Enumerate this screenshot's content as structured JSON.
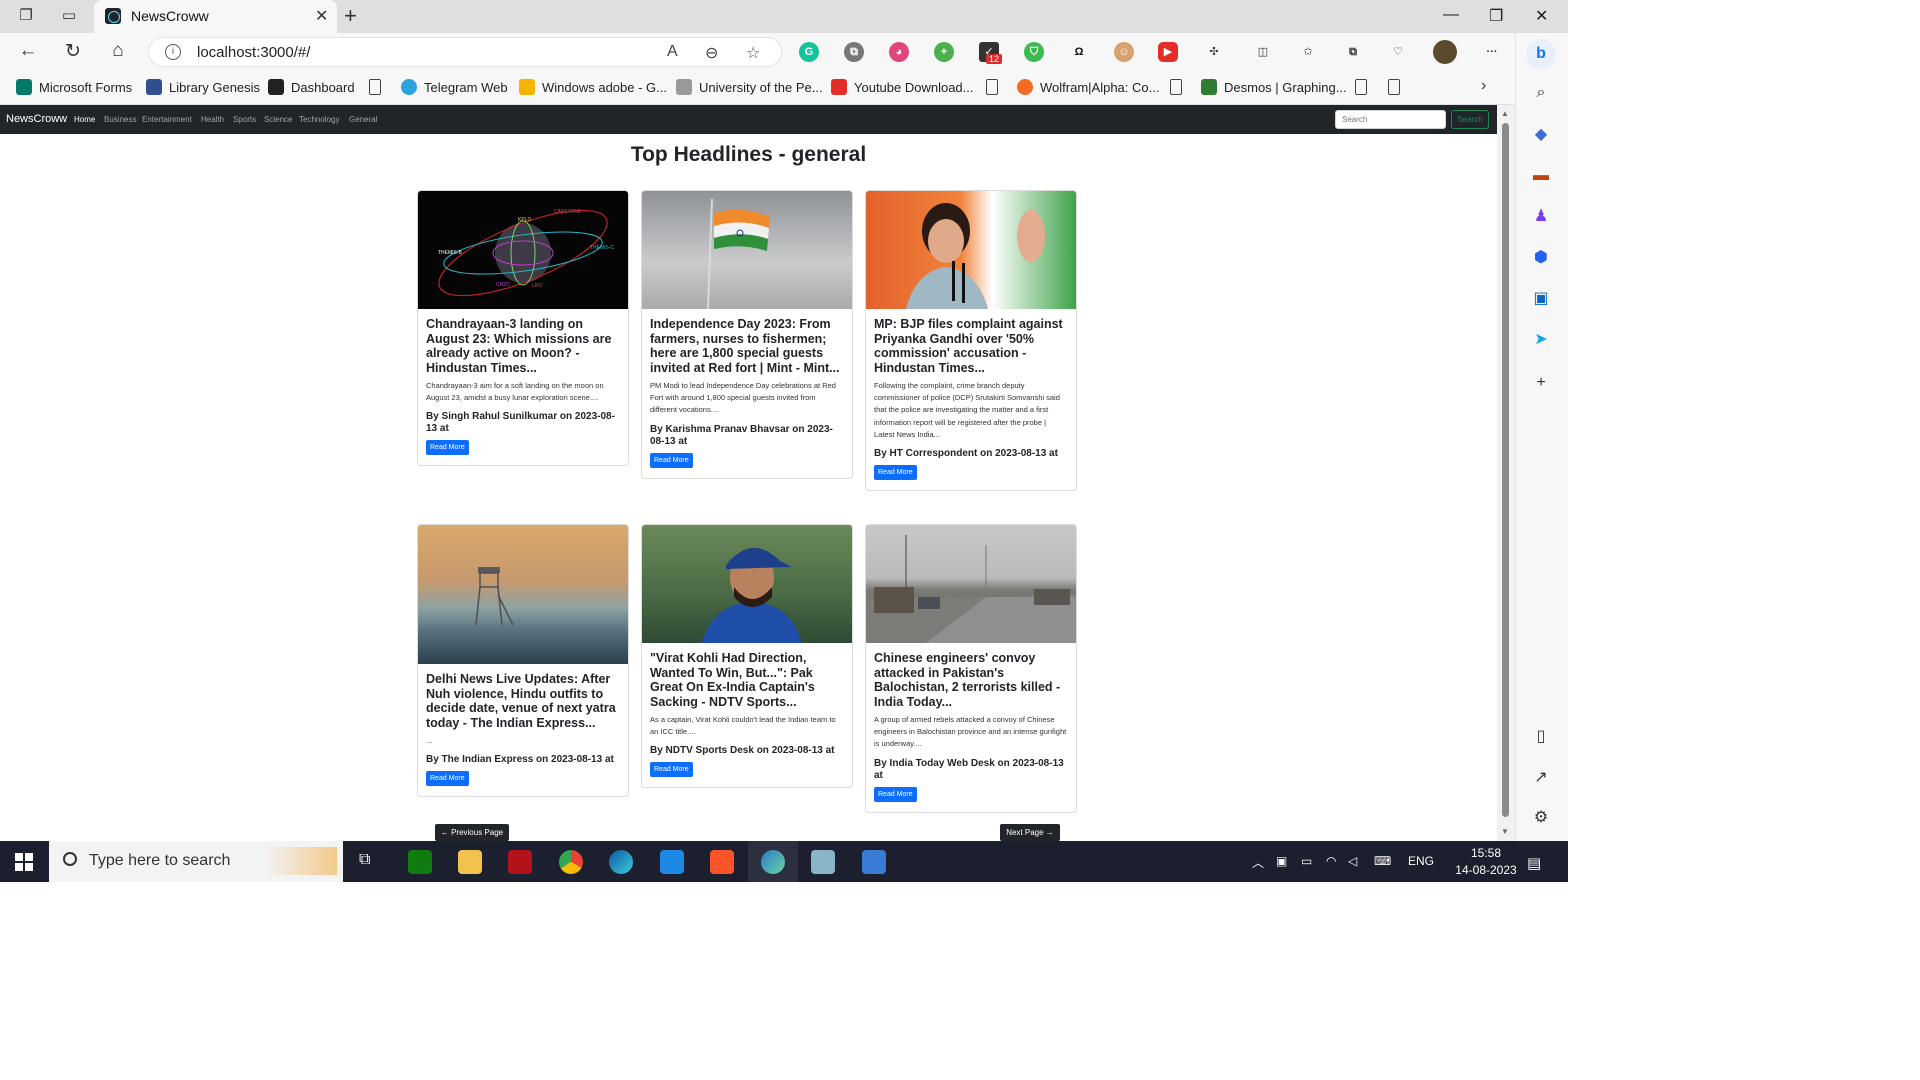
{
  "browser": {
    "tab_title": "NewsCroww",
    "url": "localhost:3000/#/",
    "bookmarks": [
      {
        "label": "Microsoft Forms",
        "color": "#047a6c"
      },
      {
        "label": "Library Genesis",
        "color": "#2f4f8f"
      },
      {
        "label": "Dashboard",
        "color": "#222222"
      },
      {
        "label": "Telegram Web",
        "color": "#2aa3df"
      },
      {
        "label": "Windows adobe - G...",
        "color": "#f4b400"
      },
      {
        "label": "University of the Pe...",
        "color": "#888888"
      },
      {
        "label": "Youtube Download...",
        "color": "#e52d27"
      },
      {
        "label": "Wolfram|Alpha: Co...",
        "color": "#f26d21"
      },
      {
        "label": "Desmos | Graphing...",
        "color": "#2e7d32"
      }
    ],
    "extension_badge": "12"
  },
  "app": {
    "brand": "NewsCroww",
    "nav": [
      "Home",
      "Business",
      "Entertainment",
      "Health",
      "Sports",
      "Science",
      "Technology",
      "General"
    ],
    "search_placeholder": "Search",
    "search_button": "Search",
    "heading": "Top Headlines - general",
    "read_more": "Read More",
    "prev_page": "← Previous Page",
    "next_page": "Next Page →"
  },
  "articles": [
    {
      "title": "Chandrayaan-3 landing on August 23: Which missions are already active on Moon? - Hindustan Times...",
      "description": "Chandrayaan-3 aim for a soft landing on the moon on August 23, amidst a busy lunar exploration scene....",
      "meta": "By Singh Rahul Sunilkumar on 2023-08-13 at"
    },
    {
      "title": "Independence Day 2023: From farmers, nurses to fishermen; here are 1,800 special guests invited at Red fort | Mint - Mint...",
      "description": "PM Modi to lead Independence Day celebrations at Red Fort with around 1,800 special guests invited from different vocations....",
      "meta": "By Karishma Pranav Bhavsar on 2023-08-13 at"
    },
    {
      "title": "MP: BJP files complaint against Priyanka Gandhi over '50% commission' accusation - Hindustan Times...",
      "description": "Following the complaint, crime branch deputy commissioner of police (DCP) Srutakirti Somvanshi said that the police are investigating the matter and a first information report will be registered after the probe | Latest News India...",
      "meta": "By HT Correspondent on 2023-08-13 at"
    },
    {
      "title": "Delhi News Live Updates: After Nuh violence, Hindu outfits to decide date, venue of next yatra today - The Indian Express...",
      "description": "...",
      "meta": "By The Indian Express on 2023-08-13 at"
    },
    {
      "title": "\"Virat Kohli Had Direction, Wanted To Win, But...\": Pak Great On Ex-India Captain's Sacking - NDTV Sports...",
      "description": "As a captain, Virat Kohli couldn't lead the Indian team to an ICC title....",
      "meta": "By NDTV Sports Desk on 2023-08-13 at"
    },
    {
      "title": "Chinese engineers' convoy attacked in Pakistan's Balochistan, 2 terrorists killed - India Today...",
      "description": "A group of armed rebels attacked a convoy of Chinese engineers in Balochistan province and an intense gunfight is underway....",
      "meta": "By India Today Web Desk on 2023-08-13 at"
    }
  ],
  "moon_labels": [
    "CAPSTONE",
    "KPLO",
    "THEMIS-B",
    "THEMIS-C",
    "CH2O",
    "LRO"
  ],
  "taskbar": {
    "search_text": "Type here to search",
    "lang": "ENG",
    "time": "15:58",
    "date": "14-08-2023"
  }
}
